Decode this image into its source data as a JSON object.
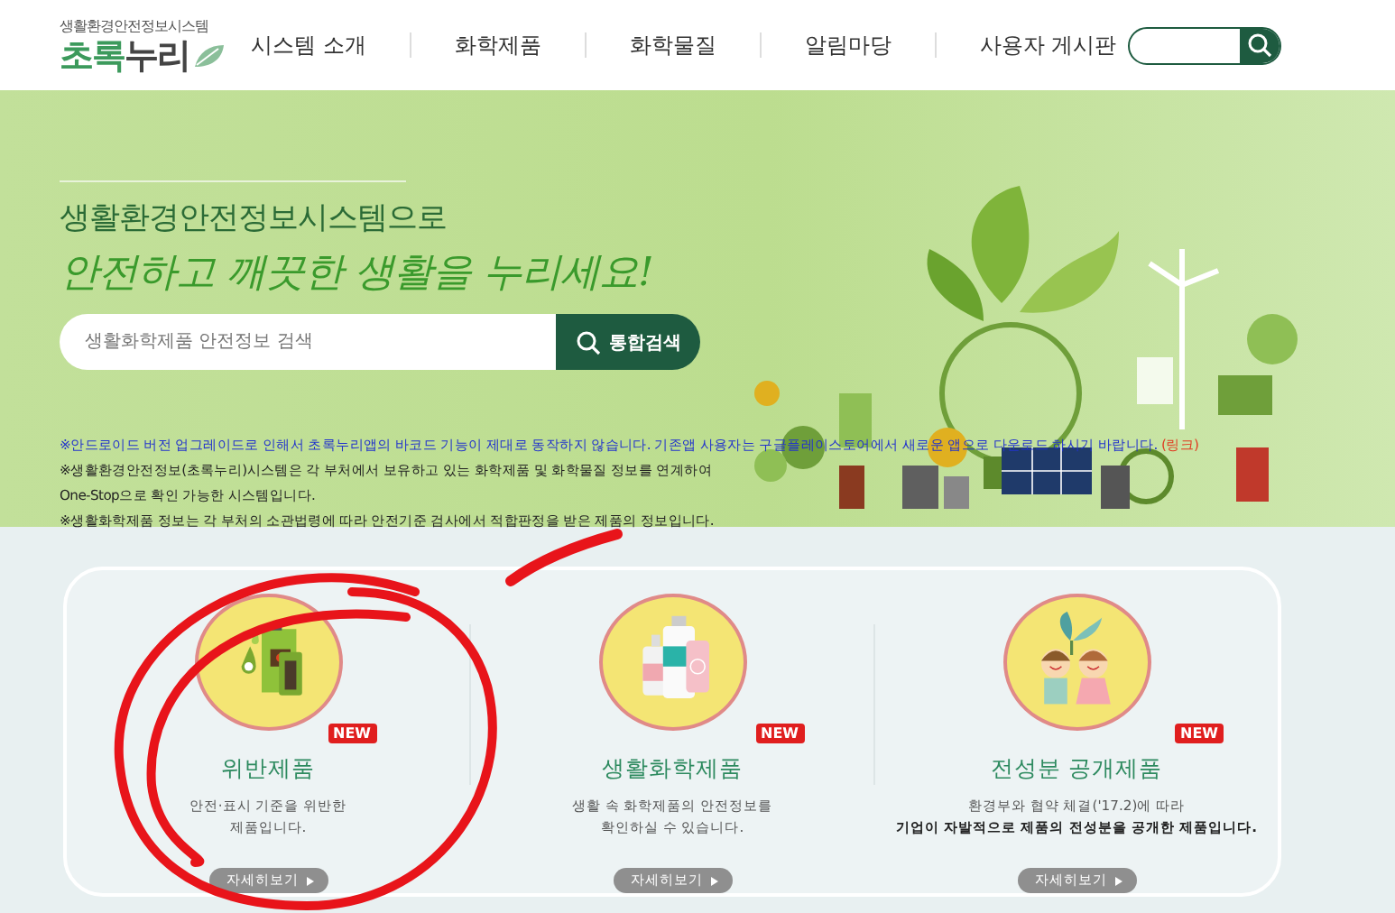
{
  "header": {
    "logo": {
      "subtitle": "생활환경안전정보시스템",
      "name_main": "초록",
      "name_rest": "누리"
    },
    "nav": [
      {
        "label": "시스템 소개"
      },
      {
        "label": "화학제품"
      },
      {
        "label": "화학물질"
      },
      {
        "label": "알림마당"
      },
      {
        "label": "사용자 게시판"
      }
    ]
  },
  "hero": {
    "heading": "생활환경안전정보시스템으로",
    "slogan": "안전하고 깨끗한 생활을 누리세요!",
    "search": {
      "placeholder": "생활화학제품 안전정보 검색",
      "button": "통합검색"
    },
    "notices": [
      {
        "kind": "alert",
        "text": "※안드로이드 버전 업그레이드로 인해서 초록누리앱의 바코드 기능이 제대로 동작하지 않습니다. 기존앱 사용자는 구글플레이스토어에서 새로운 앱으로 다운로드 하시기 바랍니다.",
        "link": "(링크)"
      },
      {
        "kind": "plain",
        "text": "※생활환경안전정보(초록누리)시스템은 각 부처에서 보유하고 있는 화학제품 및 화학물질 정보를 연계하여"
      },
      {
        "kind": "plain",
        "text": "One-Stop으로 확인 가능한 시스템입니다."
      },
      {
        "kind": "plain",
        "text": "※생활화학제품 정보는 각 부처의 소관법령에 따라 안전기준 검사에서 적합판정을 받은 제품의 정보입니다."
      }
    ]
  },
  "cards": [
    {
      "kind": "hazard",
      "title": "위반제품",
      "badge": "NEW",
      "description": [
        {
          "text": "안전·표시 기준을 위반한",
          "bold": false
        },
        {
          "text": "제품입니다.",
          "bold": false
        }
      ],
      "button": "자세히보기"
    },
    {
      "kind": "household",
      "title": "생활화학제품",
      "badge": "NEW",
      "description": [
        {
          "text": "생활 속 화학제품의 안전정보를",
          "bold": false
        },
        {
          "text": "확인하실 수 있습니다.",
          "bold": false
        }
      ],
      "button": "자세히보기"
    },
    {
      "kind": "kids",
      "title": "전성분 공개제품",
      "badge": "NEW",
      "description": [
        {
          "text": "환경부와 협약 체결('17.2)에 따라",
          "bold": false
        },
        {
          "text": "기업이 자발적으로 제품의 전성분을 공개한 제품입니다.",
          "bold": true
        }
      ],
      "button": "자세히보기"
    }
  ]
}
